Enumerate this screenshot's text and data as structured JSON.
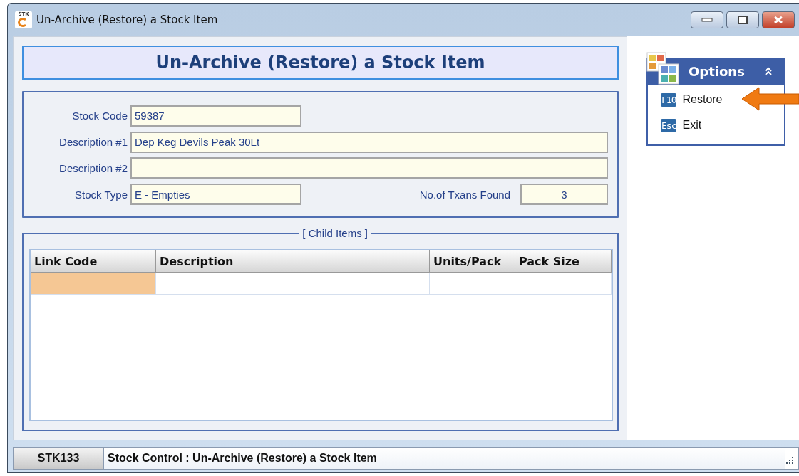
{
  "window": {
    "title": "Un-Archive (Restore) a Stock Item",
    "app_icon_text": "STK"
  },
  "header": {
    "title": "Un-Archive (Restore) a Stock Item"
  },
  "form": {
    "fields": [
      {
        "label": "Stock Code",
        "value": "59387",
        "kind": "short"
      },
      {
        "label": "Description #1",
        "value": "Dep Keg Devils Peak 30Lt",
        "kind": "wide"
      },
      {
        "label": "Description #2",
        "kind": "wide"
      },
      {
        "label": "Stock Type",
        "value": "E - Empties",
        "kind": "short"
      }
    ],
    "txans": {
      "label": "No.of Txans Found",
      "value": "3"
    }
  },
  "child_items": {
    "title": "[ Child Items ]",
    "columns": [
      "Link Code",
      "Description",
      "Units/Pack",
      "Pack Size"
    ],
    "rows": [
      {
        "selected": true
      }
    ]
  },
  "options": {
    "title": "Options",
    "expanded": true,
    "items": [
      {
        "key": "F10",
        "label": "Restore",
        "pointed": true
      },
      {
        "key": "Esc",
        "label": "Exit",
        "pointed": false
      }
    ]
  },
  "status_bar": {
    "code": "STK133",
    "text": "Stock Control : Un-Archive (Restore) a Stock Item"
  }
}
